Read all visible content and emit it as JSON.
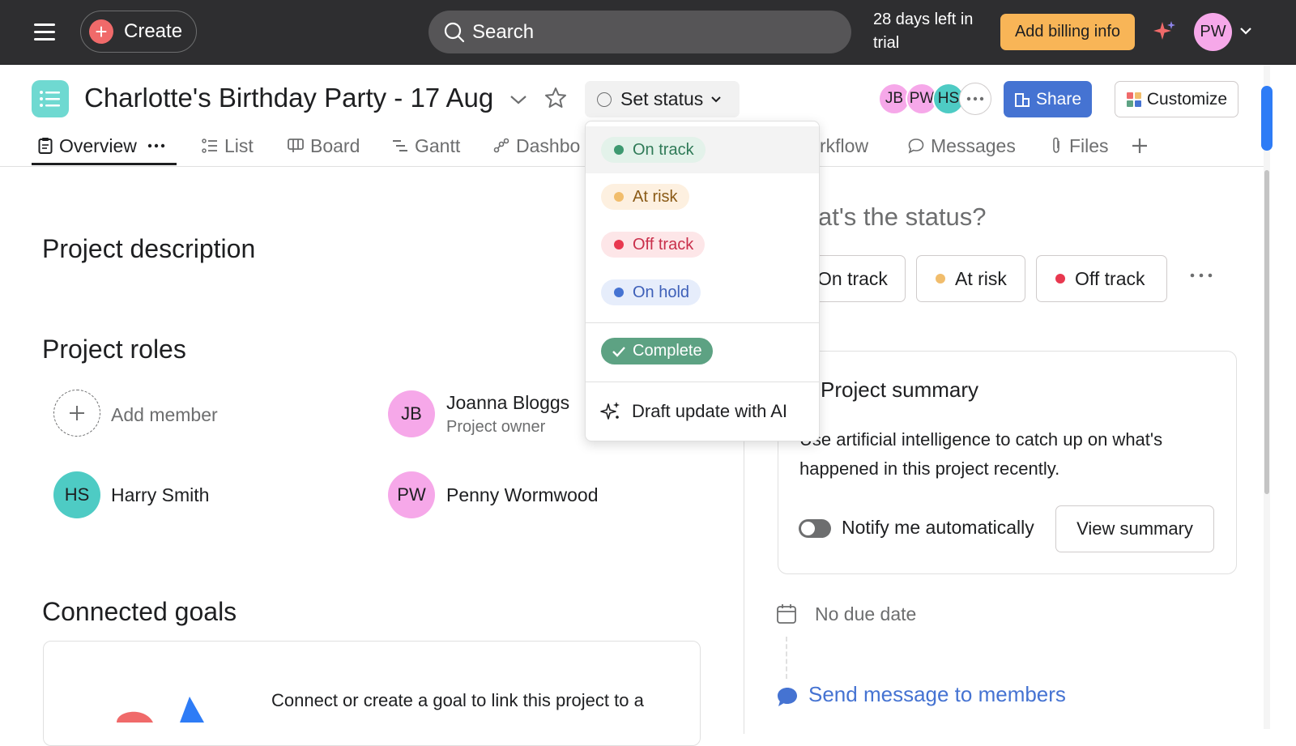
{
  "topbar": {
    "create_label": "Create",
    "search_placeholder": "Search",
    "trial_text": "28 days left in trial",
    "billing_label": "Add billing info",
    "user_initials": "PW"
  },
  "project": {
    "title": "Charlotte's Birthday Party - 17 Aug",
    "set_status_label": "Set status",
    "members": [
      {
        "initials": "JB",
        "color": "#f6a8e9"
      },
      {
        "initials": "PW",
        "color": "#f6a8e9"
      },
      {
        "initials": "HS",
        "color": "#4ecbc4"
      }
    ],
    "share_label": "Share",
    "customize_label": "Customize"
  },
  "tabs": [
    {
      "label": "Overview",
      "icon": "clipboard-icon"
    },
    {
      "label": "List",
      "icon": "list-icon"
    },
    {
      "label": "Board",
      "icon": "board-icon"
    },
    {
      "label": "Gantt",
      "icon": "gantt-icon"
    },
    {
      "label": "Dashbo",
      "icon": "dashboard-icon"
    },
    {
      "label": "rkflow",
      "icon": "workflow-icon"
    },
    {
      "label": "Messages",
      "icon": "messages-icon"
    },
    {
      "label": "Files",
      "icon": "paperclip-icon"
    }
  ],
  "main": {
    "description_heading": "Project description",
    "roles_heading": "Project roles",
    "add_member_label": "Add member",
    "roles": [
      {
        "initials": "JB",
        "name": "Joanna Bloggs",
        "role": "Project owner",
        "color": "#f6a8e9"
      },
      {
        "initials": "HS",
        "name": "Harry Smith",
        "role": "",
        "color": "#4ecbc4"
      },
      {
        "initials": "PW",
        "name": "Penny Wormwood",
        "role": "",
        "color": "#f6a8e9"
      }
    ],
    "goals_heading": "Connected goals",
    "goals_text": "Connect or create a goal to link this project to a"
  },
  "right": {
    "status_question": "at's the status?",
    "status_options": [
      {
        "label": "On track",
        "color": "#5da283"
      },
      {
        "label": "At risk",
        "color": "#f1bd6c"
      },
      {
        "label": "Off track",
        "color": "#e8384f"
      }
    ],
    "summary_title": "Project summary",
    "summary_desc": "Use artificial intelligence to catch up on what's happened in this project recently.",
    "notify_label": "Notify me automatically",
    "notify_on": false,
    "view_summary_label": "View summary",
    "due_text": "No due date",
    "send_message_label": "Send message to members"
  },
  "dropdown": {
    "items": [
      {
        "label": "On track",
        "bg": "#e3f2ea",
        "fg": "#2f7a57",
        "dot": "#3d9970"
      },
      {
        "label": "At risk",
        "bg": "#fdf0e0",
        "fg": "#8a5a16",
        "dot": "#f1bd6c"
      },
      {
        "label": "Off track",
        "bg": "#fde6e8",
        "fg": "#c92f4b",
        "dot": "#e8384f"
      },
      {
        "label": "On hold",
        "bg": "#e6edfb",
        "fg": "#3d5fb8",
        "dot": "#4573d2"
      }
    ],
    "complete_label": "Complete",
    "ai_label": "Draft update with AI"
  }
}
